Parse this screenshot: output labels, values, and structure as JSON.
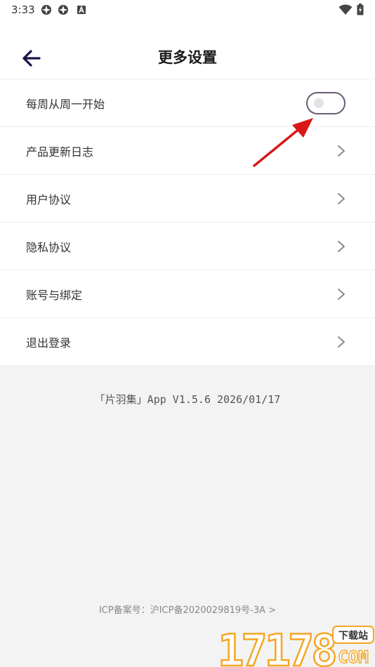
{
  "status_bar": {
    "time": "3:33"
  },
  "header": {
    "title": "更多设置"
  },
  "settings": {
    "items": [
      {
        "label": "每周从周一开始",
        "control": "toggle",
        "enabled": false
      },
      {
        "label": "产品更新日志",
        "control": "chevron"
      },
      {
        "label": "用户协议",
        "control": "chevron"
      },
      {
        "label": "隐私协议",
        "control": "chevron"
      },
      {
        "label": "账号与绑定",
        "control": "chevron"
      },
      {
        "label": "退出登录",
        "control": "chevron"
      }
    ]
  },
  "footer": {
    "app_version": "「片羽集」App V1.5.6 2026/01/17",
    "icp": "ICP备案号：沪ICP备2020029819号-3A >"
  },
  "watermark": {
    "number": "17178",
    "badge": "下载站",
    "domain": "COM"
  },
  "colors": {
    "accent": "#1a1446",
    "toggle_border": "#6b5d74",
    "annotation_arrow": "#d81818",
    "watermark_orange": "#f5a623"
  }
}
